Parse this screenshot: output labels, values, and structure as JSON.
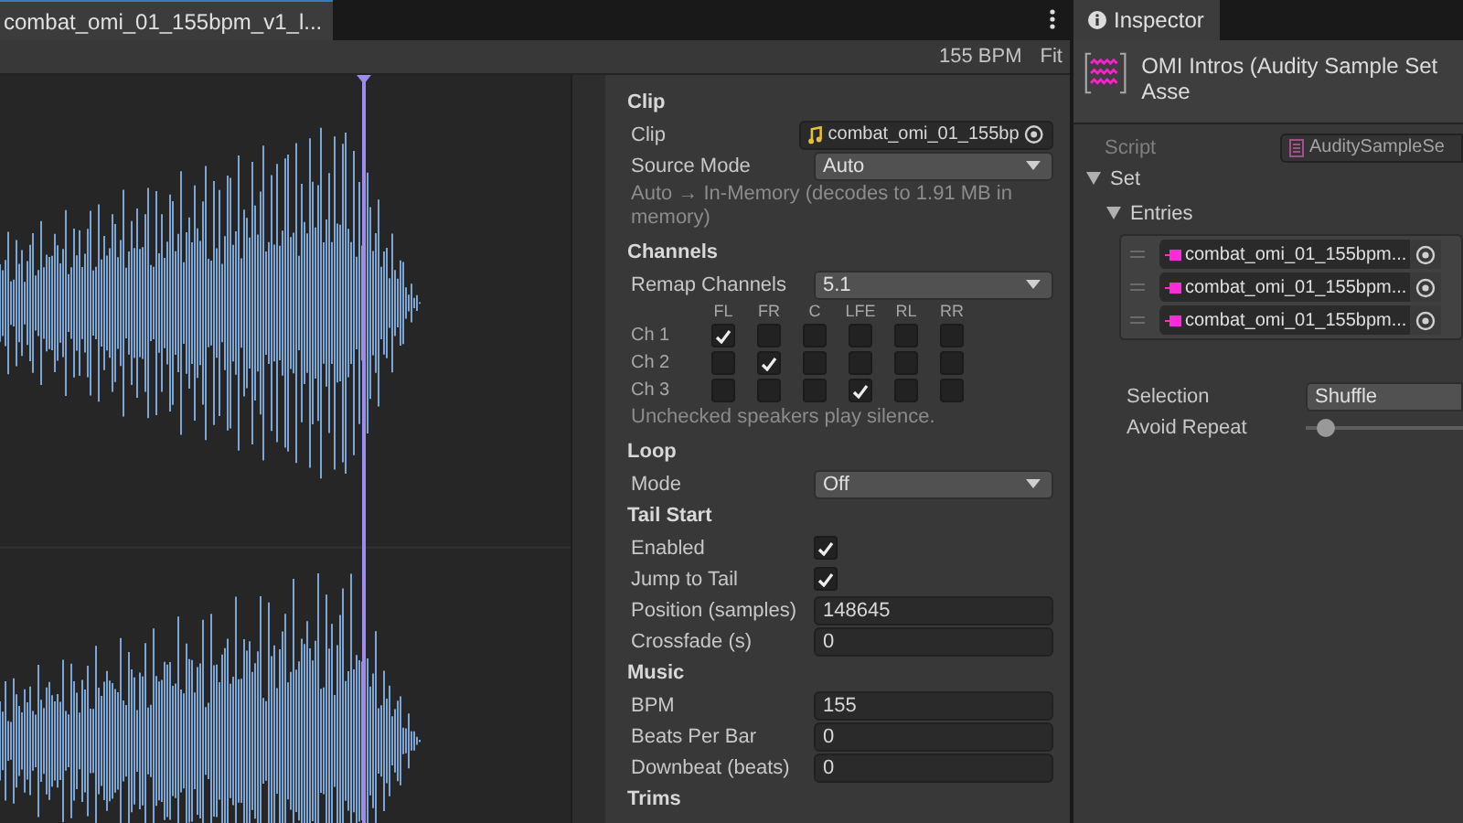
{
  "editor_tab": {
    "title": "combat_omi_01_155bpm_v1_l..."
  },
  "toolbar": {
    "bpm": "155 BPM",
    "zoom": "Fit"
  },
  "settings": [
    {
      "title": "Clip",
      "rows": [
        {
          "kind": "object",
          "label": "Clip",
          "value": "combat_omi_01_155bp"
        },
        {
          "kind": "dropdown",
          "label": "Source Mode",
          "value": "Auto"
        },
        {
          "kind": "note",
          "text": "Auto → In-Memory (decodes to 1.91 MB in memory)"
        }
      ]
    },
    {
      "title": "Channels",
      "rows": [
        {
          "kind": "dropdown",
          "label": "Remap Channels",
          "value": "5.1"
        },
        {
          "kind": "matrix",
          "columns": [
            "FL",
            "FR",
            "C",
            "LFE",
            "RL",
            "RR"
          ],
          "channels": [
            {
              "label": "Ch 1",
              "cells": [
                {
                  "checked": true
                },
                {
                  "checked": false
                },
                {
                  "checked": false
                },
                {
                  "checked": false
                },
                {
                  "checked": false
                },
                {
                  "checked": false
                }
              ]
            },
            {
              "label": "Ch 2",
              "cells": [
                {
                  "checked": false
                },
                {
                  "checked": true
                },
                {
                  "checked": false
                },
                {
                  "checked": false
                },
                {
                  "checked": false
                },
                {
                  "checked": false
                }
              ]
            },
            {
              "label": "Ch 3",
              "cells": [
                {
                  "checked": false
                },
                {
                  "checked": false
                },
                {
                  "checked": false
                },
                {
                  "checked": true
                },
                {
                  "checked": false
                },
                {
                  "checked": false
                }
              ]
            }
          ]
        },
        {
          "kind": "note",
          "text": "Unchecked speakers play silence."
        }
      ]
    },
    {
      "title": "Loop",
      "rows": [
        {
          "kind": "dropdown",
          "label": "Mode",
          "value": "Off"
        }
      ]
    },
    {
      "title": "Tail Start",
      "rows": [
        {
          "kind": "checkbox",
          "label": "Enabled",
          "checked": true
        },
        {
          "kind": "checkbox",
          "label": "Jump to Tail",
          "checked": true
        },
        {
          "kind": "number",
          "label": "Position (samples)",
          "value": "148645"
        },
        {
          "kind": "number",
          "label": "Crossfade (s)",
          "value": "0"
        }
      ]
    },
    {
      "title": "Music",
      "rows": [
        {
          "kind": "number",
          "label": "BPM",
          "value": "155"
        },
        {
          "kind": "number",
          "label": "Beats Per Bar",
          "value": "0"
        },
        {
          "kind": "number",
          "label": "Downbeat (beats)",
          "value": "0"
        }
      ]
    },
    {
      "title": "Trims"
    }
  ],
  "inspector": {
    "tab": "Inspector",
    "title": "OMI Intros (Audity Sample Set Asse",
    "script": {
      "label": "Script",
      "value": "AuditySampleSe"
    },
    "set": {
      "label": "Set",
      "expanded": true,
      "entries": {
        "label": "Entries",
        "expanded": true,
        "items": [
          "combat_omi_01_155bpm...",
          "combat_omi_01_155bpm...",
          "combat_omi_01_155bpm..."
        ]
      }
    },
    "selection": {
      "label": "Selection",
      "value": "Shuffle"
    },
    "avoid_repeat": {
      "label": "Avoid Repeat",
      "level": 0.12
    }
  }
}
